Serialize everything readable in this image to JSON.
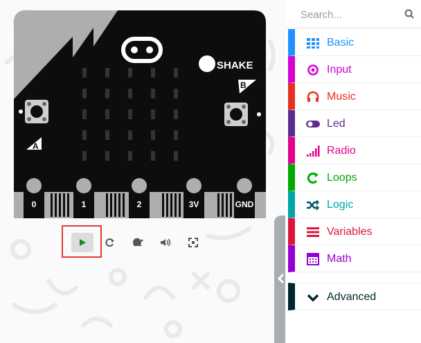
{
  "simulator": {
    "shake_label": "SHAKE",
    "button_a": "A",
    "button_b": "B",
    "pins": [
      "0",
      "1",
      "2",
      "3V",
      "GND"
    ],
    "controls": [
      {
        "name": "play-button",
        "icon": "play-icon"
      },
      {
        "name": "restart-button",
        "icon": "restart-icon"
      },
      {
        "name": "slow-mo-button",
        "icon": "snail-icon"
      },
      {
        "name": "mute-button",
        "icon": "speaker-icon"
      },
      {
        "name": "fullscreen-button",
        "icon": "fullscreen-icon"
      }
    ]
  },
  "toolbox": {
    "search_placeholder": "Search...",
    "categories": [
      {
        "label": "Basic",
        "color": "#1E90FF",
        "icon": "grid-icon"
      },
      {
        "label": "Input",
        "color": "#D400D4",
        "icon": "target-icon"
      },
      {
        "label": "Music",
        "color": "#E63022",
        "icon": "headphones-icon"
      },
      {
        "label": "Led",
        "color": "#5C2D91",
        "icon": "toggle-icon"
      },
      {
        "label": "Radio",
        "color": "#E3008C",
        "icon": "signal-icon"
      },
      {
        "label": "Loops",
        "color": "#00AA00",
        "icon": "loop-icon"
      },
      {
        "label": "Logic",
        "color": "#00A4A6",
        "icon": "shuffle-icon"
      },
      {
        "label": "Variables",
        "color": "#DC143C",
        "icon": "list-icon"
      },
      {
        "label": "Math",
        "color": "#9400D3",
        "icon": "calculator-icon"
      },
      {
        "label": "Advanced",
        "color": "#00272B",
        "icon": "chevron-down-icon"
      }
    ]
  }
}
